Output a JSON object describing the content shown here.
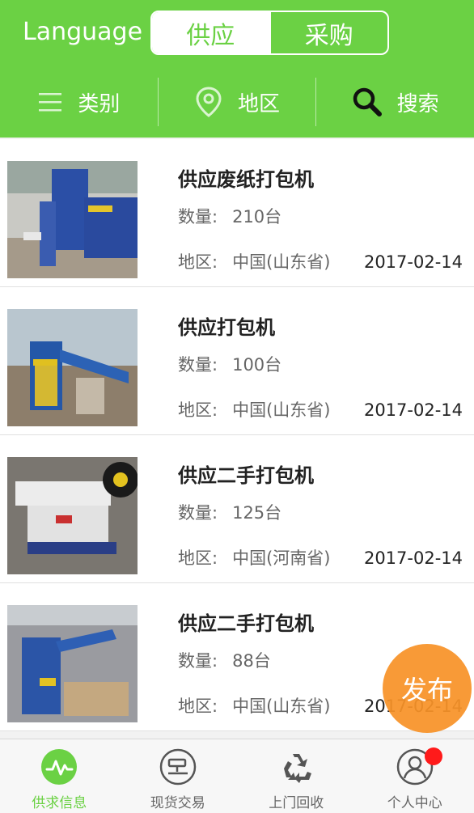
{
  "header": {
    "language_label": "Language",
    "segments": [
      {
        "label": "供应",
        "active": true
      },
      {
        "label": "采购",
        "active": false
      }
    ],
    "filters": {
      "category": {
        "label": "类别",
        "icon": "menu-icon"
      },
      "region": {
        "label": "地区",
        "icon": "location-pin-icon"
      },
      "search": {
        "label": "搜索",
        "icon": "search-icon"
      }
    }
  },
  "listings": [
    {
      "title": "供应废纸打包机",
      "qty_label": "数量:",
      "qty": "210台",
      "region_label": "地区:",
      "region": "中国(山东省)",
      "date": "2017-02-14"
    },
    {
      "title": "供应打包机",
      "qty_label": "数量:",
      "qty": "100台",
      "region_label": "地区:",
      "region": "中国(山东省)",
      "date": "2017-02-14"
    },
    {
      "title": "供应二手打包机",
      "qty_label": "数量:",
      "qty": "125台",
      "region_label": "地区:",
      "region": "中国(河南省)",
      "date": "2017-02-14"
    },
    {
      "title": "供应二手打包机",
      "qty_label": "数量:",
      "qty": "88台",
      "region_label": "地区:",
      "region": "中国(山东省)",
      "date": "2017-02-14"
    }
  ],
  "fab": {
    "label": "发布"
  },
  "tabbar": [
    {
      "label": "供求信息",
      "icon": "pulse-icon",
      "active": true
    },
    {
      "label": "现货交易",
      "icon": "gavel-icon",
      "active": false
    },
    {
      "label": "上门回收",
      "icon": "recycle-icon",
      "active": false
    },
    {
      "label": "个人中心",
      "icon": "user-icon",
      "active": false,
      "badge": true
    }
  ],
  "colors": {
    "brand_green": "#6bd144",
    "fab_orange": "#f79228",
    "badge_red": "#ff1a1a"
  }
}
